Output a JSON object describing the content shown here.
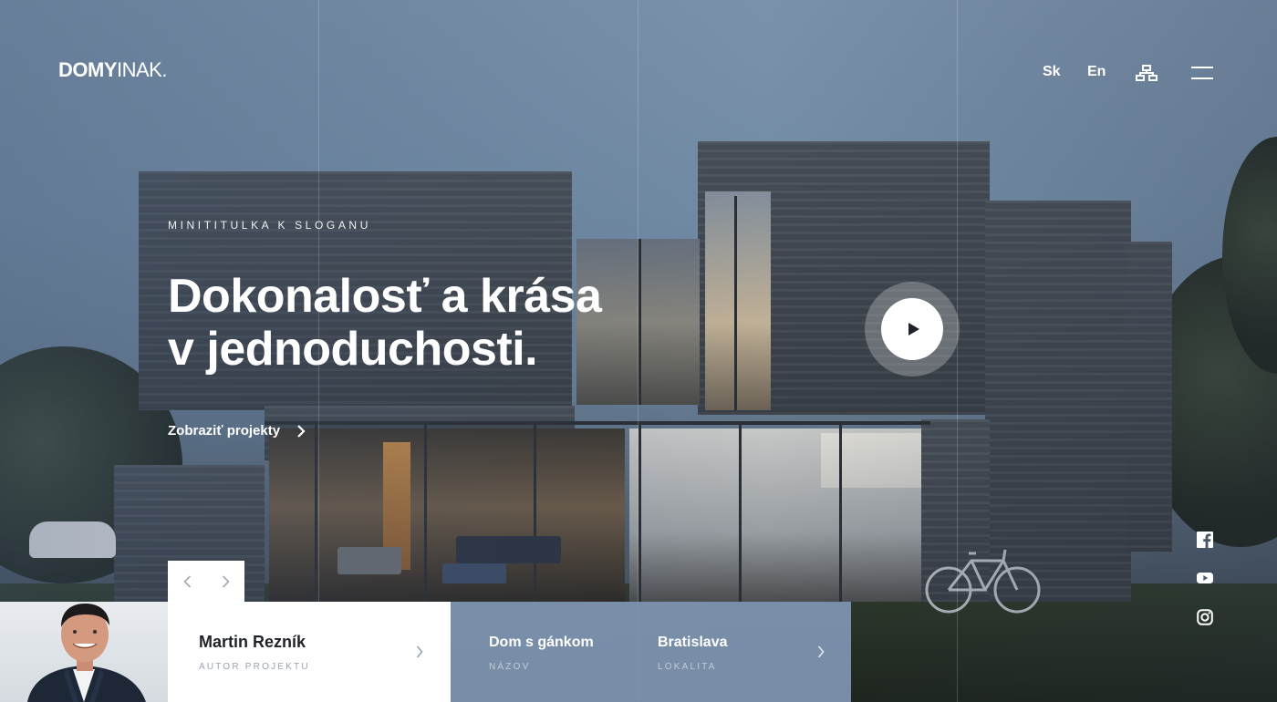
{
  "header": {
    "logo_bold": "DOMY",
    "logo_light": "INAK.",
    "lang_sk": "Sk",
    "lang_en": "En",
    "sitemap_icon": "sitemap-icon",
    "menu_icon": "hamburger-icon"
  },
  "hero": {
    "kicker": "MINITITULKA K SLOGANU",
    "headline_line1": "Dokonalosť a krása",
    "headline_line2": "v jednoduchosti.",
    "cta_label": "Zobraziť projekty"
  },
  "author": {
    "name": "Martin Rezník",
    "role": "AUTOR PROJEKTU"
  },
  "project": {
    "name": "Dom s gánkom",
    "name_label": "NÁZOV",
    "location": "Bratislava",
    "location_label": "LOKALITA"
  },
  "social": [
    "facebook-icon",
    "youtube-icon",
    "instagram-icon"
  ],
  "colors": {
    "project_card": "#849bb9",
    "author_card": "#ffffff",
    "text_dark": "#1f2329"
  }
}
